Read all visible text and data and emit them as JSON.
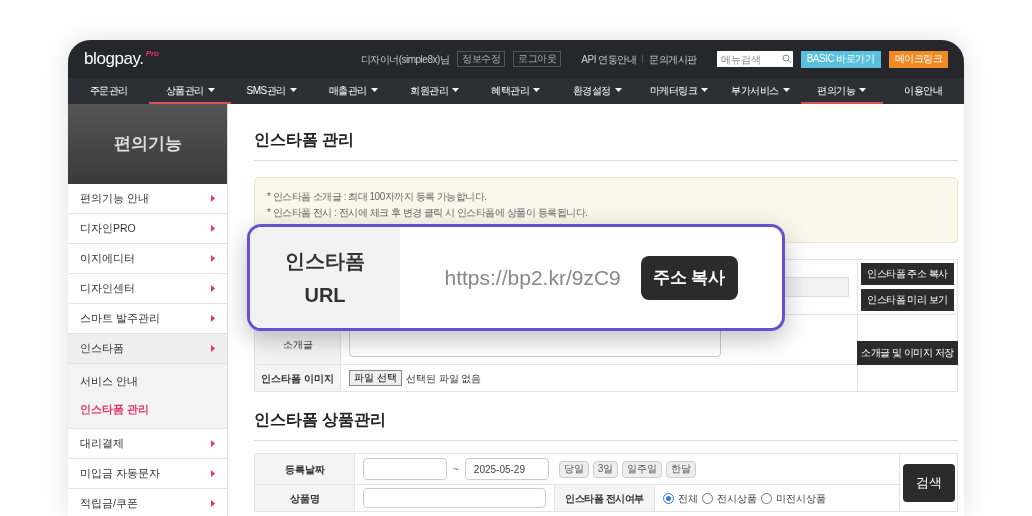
{
  "header": {
    "logo": "blogpay.",
    "logo_badge": "Pro",
    "user": "디자이너(simple8x)님",
    "account_buttons": [
      "정보수정",
      "로그아웃"
    ],
    "links": [
      "API 연동안내",
      "문의게시판"
    ],
    "search": {
      "placeholder": "메뉴검색"
    },
    "action_buttons": [
      {
        "label": "BASIC 바로가기",
        "color": "#5bc0de"
      },
      {
        "label": "메이크링크",
        "color": "#f28a24"
      }
    ]
  },
  "nav": [
    {
      "label": "주문관리",
      "dropdown": false,
      "selected": false
    },
    {
      "label": "상품관리",
      "dropdown": true,
      "selected": true
    },
    {
      "label": "SMS관리",
      "dropdown": true,
      "selected": false
    },
    {
      "label": "매출관리",
      "dropdown": true,
      "selected": false
    },
    {
      "label": "회원관리",
      "dropdown": true,
      "selected": false
    },
    {
      "label": "혜택관리",
      "dropdown": true,
      "selected": false
    },
    {
      "label": "환경설정",
      "dropdown": true,
      "selected": false
    },
    {
      "label": "마케터링크",
      "dropdown": true,
      "selected": false
    },
    {
      "label": "부가서비스",
      "dropdown": true,
      "selected": false
    },
    {
      "label": "편의기능",
      "dropdown": true,
      "selected": true
    },
    {
      "label": "이용안내",
      "dropdown": false,
      "selected": false
    }
  ],
  "sidebar": {
    "title": "편의기능",
    "items": [
      {
        "label": "편의기능 안내",
        "selected": false
      },
      {
        "label": "디자인PRO",
        "selected": false
      },
      {
        "label": "이지에디터",
        "selected": false
      },
      {
        "label": "디자인센터",
        "selected": false
      },
      {
        "label": "스마트 발주관리",
        "selected": false
      },
      {
        "label": "인스타폼",
        "selected": true,
        "children": [
          {
            "label": "서비스 안내",
            "selected": false
          },
          {
            "label": "인스타폼 관리",
            "selected": true
          }
        ]
      },
      {
        "label": "대리결제",
        "selected": false
      },
      {
        "label": "미입금 자동문자",
        "selected": false
      },
      {
        "label": "적립금/쿠폰",
        "selected": false
      }
    ]
  },
  "manage": {
    "title": "인스타폼 관리",
    "notices": [
      "* 인스타폼 소개글 : 최대 100자까지 등록 가능합니다.",
      "* 인스타폼 전시 : 전시에 체크 후 변경 클릭 시 인스타폼에 상품이 등록됩니다."
    ],
    "side_buttons": [
      "인스타폼 주소 복사",
      "인스타폼 미리 보기"
    ],
    "intro_label": "소개글",
    "save_button": "소개글 및 이미지 저장",
    "image_label": "인스타폼 이미지",
    "file_button": "파일 선택",
    "file_status": "선택된 파일 없음"
  },
  "callout": {
    "label_lines": [
      "인스타폼",
      "URL"
    ],
    "url": "https://bp2.kr/9zC9",
    "button": "주소 복사"
  },
  "products": {
    "title": "인스타폼 상품관리",
    "date_label": "등록날짜",
    "date_separator": "~",
    "date_to": "2025-05-29",
    "ranges": [
      "당일",
      "3일",
      "일주일",
      "한달"
    ],
    "name_label": "상품명",
    "display_label": "인스타폼 전시여부",
    "display_options": [
      {
        "label": "전체",
        "selected": true
      },
      {
        "label": "전시상품",
        "selected": false
      },
      {
        "label": "미전시상품",
        "selected": false
      }
    ],
    "search_button": "검색"
  }
}
